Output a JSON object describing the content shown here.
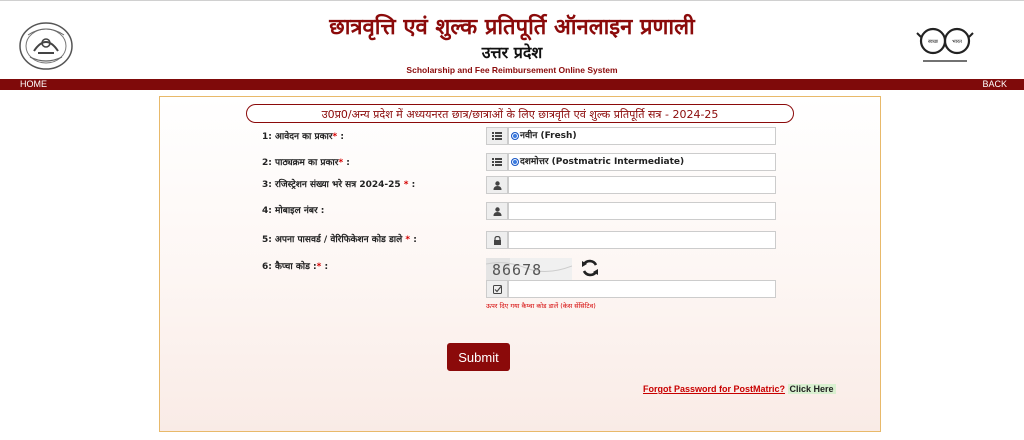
{
  "header": {
    "title_hi": "छात्रवृत्ति एवं शुल्क प्रतिपूर्ति ऑनलाइन प्रणाली",
    "subtitle_hi": "उत्तर प्रदेश",
    "title_en": "Scholarship and Fee Reimbursement Online System",
    "logo_left": "up-government-emblem",
    "logo_right": "swachh-bharat-logo"
  },
  "nav": {
    "home": "HOME",
    "back": "BACK"
  },
  "form": {
    "session_title": "उ0प्र0/अन्य प्रदेश में अध्ययनरत छात्र/छात्राओं के लिए छात्रवृति एवं शुल्क प्रतिपूर्ति सत्र - 2024-25",
    "fields": [
      {
        "label": "1: आवेदन का प्रकार",
        "required": "*",
        "suffix": " :",
        "icon": "list-icon",
        "value": "नवीन (Fresh)"
      },
      {
        "label": "2: पाठ्यक्रम का प्रकार",
        "required": "*",
        "suffix": " :",
        "icon": "list-icon",
        "value": "दशमोत्तर (Postmatric Intermediate)"
      },
      {
        "label": "3: रजिस्ट्रेशन संख्या भरे सत्र 2024-25",
        "required": "*",
        "suffix": " :",
        "icon": "user-icon",
        "value": ""
      },
      {
        "label": "4: मोबाइल नंबर",
        "required": "",
        "suffix": " :",
        "icon": "user-icon",
        "value": ""
      },
      {
        "label": "5: अपना पासवर्ड / वेरिफिकेशन कोड डाले",
        "required": "*",
        "suffix": " :",
        "icon": "lock-icon",
        "value": ""
      },
      {
        "label": "6: कैप्चा कोड :",
        "required": "*",
        "suffix": " :",
        "icon": "check-icon",
        "value": ""
      }
    ],
    "captcha_text": "86678",
    "captcha_hint": "ऊपर दिए गया कैप्चा कोड डालें (केस सेंसिटिव)",
    "submit_label": "Submit",
    "forgot_text": "Forgot Password for PostMatric?",
    "click_here": "Click Here"
  },
  "colors": {
    "brand": "#8b0a0a",
    "nav": "#7f0a0a",
    "required": "#d40000",
    "panel_border": "#e8b96a"
  }
}
